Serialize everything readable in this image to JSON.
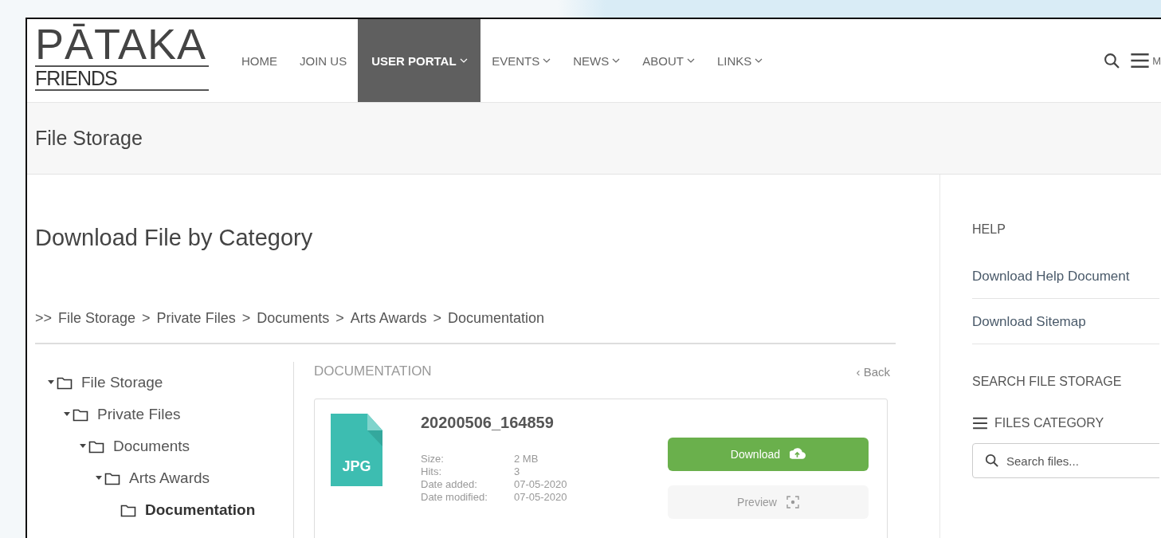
{
  "logo": {
    "title": "PĀTAKA",
    "subtitle": "FRIENDS"
  },
  "nav": [
    {
      "label": "HOME",
      "selected": false,
      "dropdown": false
    },
    {
      "label": "JOIN US",
      "selected": false,
      "dropdown": false
    },
    {
      "label": "USER PORTAL",
      "selected": true,
      "dropdown": true
    },
    {
      "label": "EVENTS",
      "selected": false,
      "dropdown": true
    },
    {
      "label": "NEWS",
      "selected": false,
      "dropdown": true
    },
    {
      "label": "ABOUT",
      "selected": false,
      "dropdown": true
    },
    {
      "label": "LINKS",
      "selected": false,
      "dropdown": true
    }
  ],
  "menu_label": "M",
  "page_title": "File Storage",
  "heading": "Download File by Category",
  "breadcrumb": {
    "lead": ">>",
    "items": [
      "File Storage",
      "Private Files",
      "Documents",
      "Arts Awards",
      "Documentation"
    ],
    "separator": ">"
  },
  "tree": [
    {
      "label": "File Storage",
      "expanded": true,
      "selected": false,
      "children": [
        {
          "label": "Private Files",
          "expanded": true,
          "selected": false,
          "children": [
            {
              "label": "Documents",
              "expanded": true,
              "selected": false,
              "children": [
                {
                  "label": "Arts Awards",
                  "expanded": true,
                  "selected": false,
                  "children": [
                    {
                      "label": "Documentation",
                      "selected": true
                    }
                  ]
                }
              ]
            }
          ]
        }
      ]
    }
  ],
  "category": {
    "title": "DOCUMENTATION",
    "back": "‹ Back"
  },
  "file": {
    "type": "JPG",
    "name": "20200506_164859",
    "meta": [
      {
        "label": "Size:",
        "value": "2 MB"
      },
      {
        "label": "Hits:",
        "value": "3"
      },
      {
        "label": "Date added:",
        "value": "07-05-2020"
      },
      {
        "label": "Date modified:",
        "value": "07-05-2020"
      }
    ],
    "download": "Download",
    "preview": "Preview"
  },
  "sidebar": {
    "help_title": "HELP",
    "links": [
      "Download Help Document",
      "Download Sitemap"
    ],
    "search_title": "SEARCH FILE STORAGE",
    "category_label": "FILES CATEGORY",
    "search": {
      "placeholder": "Search files..."
    }
  }
}
